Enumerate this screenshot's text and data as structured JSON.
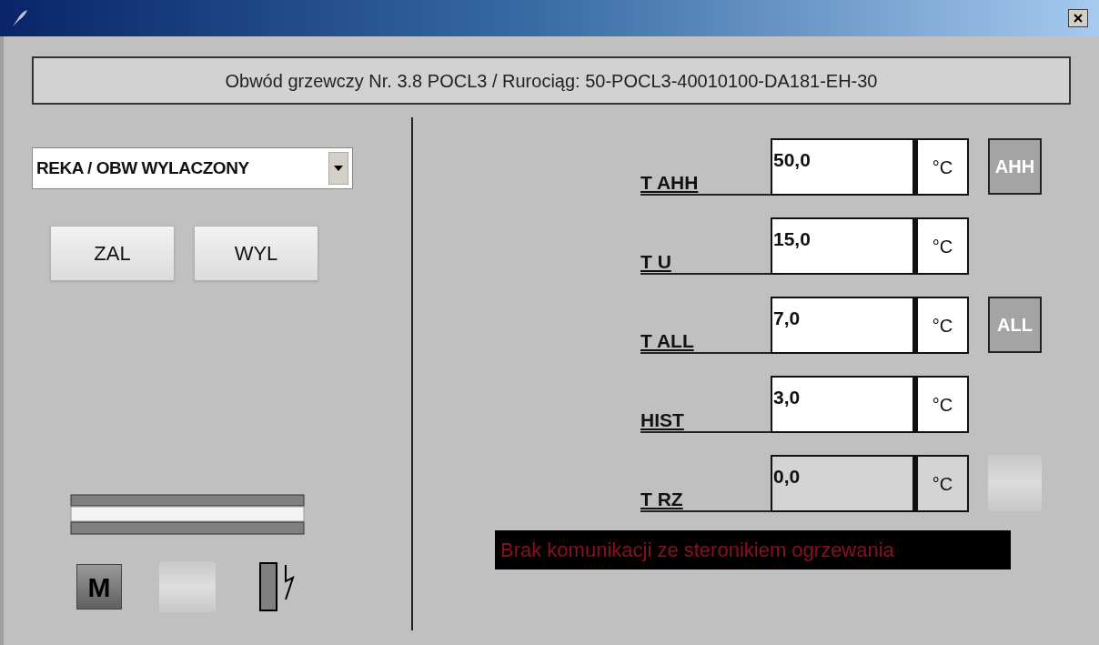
{
  "header": "Obwód grzewczy Nr. 3.8 POCL3 / Rurociąg: 50-POCL3-40010100-DA181-EH-30",
  "mode_select": {
    "value": "REKA / OBW WYLACZONY"
  },
  "buttons": [
    "ZAL",
    "WYL"
  ],
  "status": {
    "mode_letter": "M"
  },
  "rows": [
    {
      "label": "T AHH",
      "value": "50,0",
      "unit": "°C",
      "disabled": false,
      "indicator": {
        "kind": "labeled",
        "text": "AHH"
      }
    },
    {
      "label": "T U",
      "value": "15,0",
      "unit": "°C",
      "disabled": false
    },
    {
      "label": "T ALL",
      "value": "7,0",
      "unit": "°C",
      "disabled": false,
      "indicator": {
        "kind": "labeled",
        "text": "ALL"
      }
    },
    {
      "label": "HIST",
      "value": "3,0",
      "unit": "°C",
      "disabled": false
    },
    {
      "label": "T RZ",
      "value": "0,0",
      "unit": "°C",
      "disabled": true,
      "indicator": {
        "kind": "lamp"
      }
    }
  ],
  "message": "Brak komunikacji ze steronikiem ogrzewania"
}
